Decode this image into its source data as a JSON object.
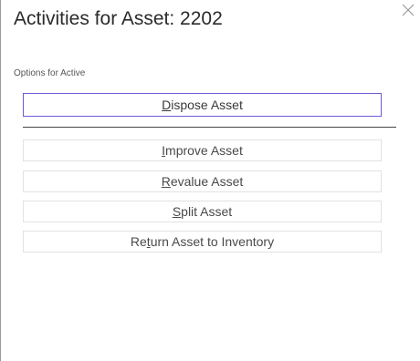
{
  "dialog": {
    "title": "Activities for Asset: 2202",
    "close_icon": "close-icon"
  },
  "section": {
    "label": "Options for Active"
  },
  "buttons": [
    {
      "pre": "",
      "mnemonic": "D",
      "post": "ispose Asset"
    },
    {
      "pre": "",
      "mnemonic": "I",
      "post": "mprove Asset"
    },
    {
      "pre": "",
      "mnemonic": "R",
      "post": "evalue Asset"
    },
    {
      "pre": "",
      "mnemonic": "S",
      "post": "plit Asset"
    },
    {
      "pre": "Re",
      "mnemonic": "t",
      "post": "urn Asset to Inventory"
    }
  ],
  "colors": {
    "focused_border": "#6b5bd6",
    "button_border": "#e2e2e2"
  }
}
